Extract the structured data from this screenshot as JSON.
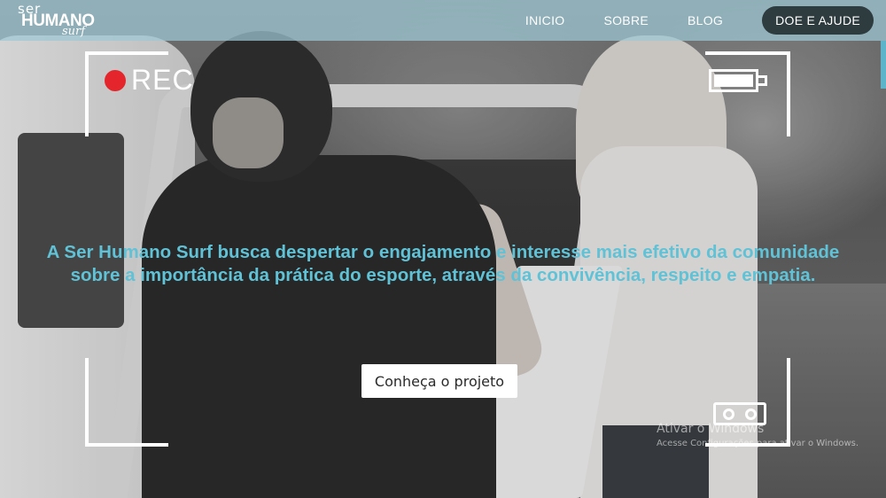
{
  "brand": {
    "logo_ser": "ser",
    "logo_humano": "HUMANO",
    "logo_surf": "surf"
  },
  "nav": {
    "items": [
      "INICIO",
      "SOBRE",
      "BLOG"
    ],
    "cta": "DOE E AJUDE"
  },
  "camera": {
    "rec_label": "REC"
  },
  "hero": {
    "headline": "A Ser Humano Surf busca despertar o engajamento e interesse mais efetivo da comunidade sobre a importância da prática do esporte, através da convivência, respeito e empatia.",
    "button_label": "Conheça o projeto"
  },
  "watermark": {
    "title": "Ativar o Windows",
    "subtitle": "Acesse Configurações para ativar o Windows."
  },
  "colors": {
    "accent": "#5fc2d6",
    "header_bg": "#9cc8d4",
    "cta_bg": "#2e3b3f",
    "rec_dot": "#e4262c"
  }
}
